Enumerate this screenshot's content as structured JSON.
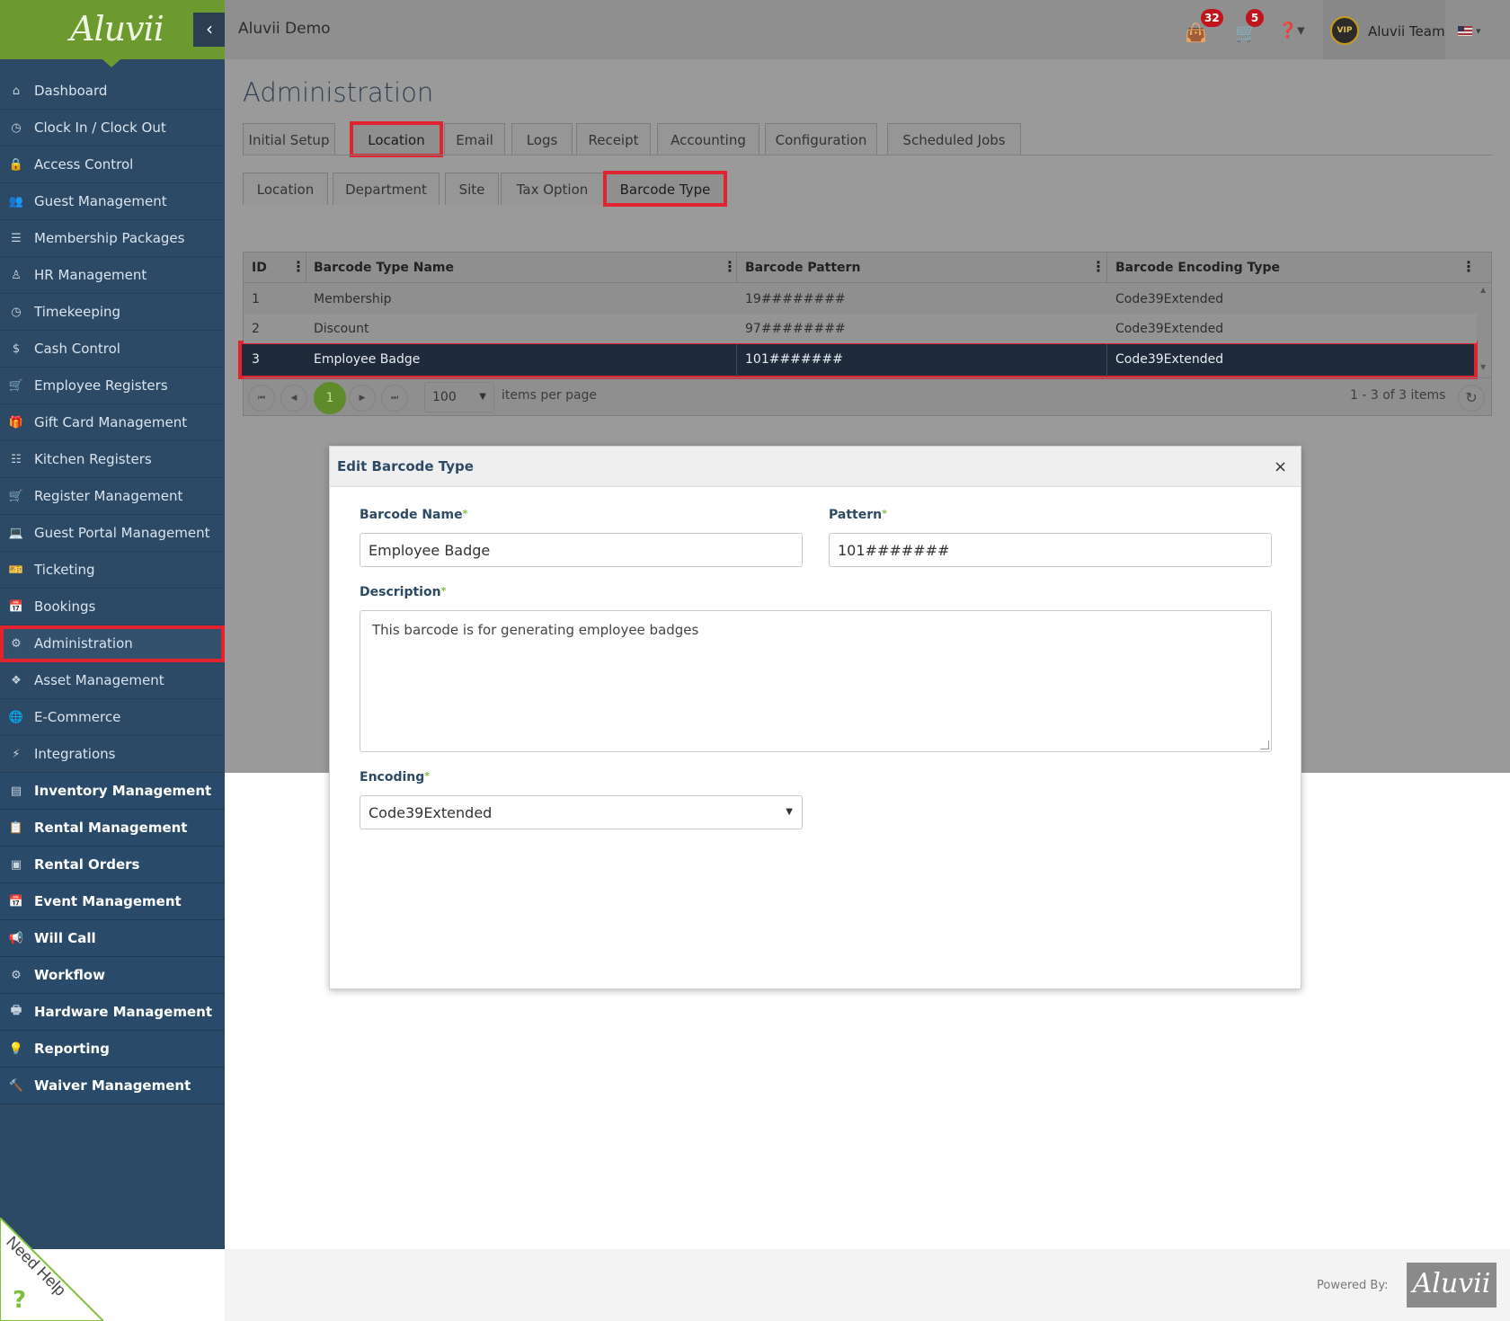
{
  "app": {
    "logo": "Aluvii",
    "title": "Aluvii Demo",
    "collapse_icon": "chevron-left-icon"
  },
  "topbar": {
    "bag_badge": "32",
    "cart_badge": "5",
    "user_name": "Aluvii Team",
    "avatar_text": "VIP",
    "help_icon": "question-circle-icon",
    "language": "en-US"
  },
  "sidebar": {
    "items": [
      {
        "label": "Dashboard",
        "icon": "home-icon",
        "glyph": "⌂"
      },
      {
        "label": "Clock In / Clock Out",
        "icon": "clock-icon",
        "glyph": "◷"
      },
      {
        "label": "Access Control",
        "icon": "lock-icon",
        "glyph": "🔒"
      },
      {
        "label": "Guest Management",
        "icon": "users-icon",
        "glyph": "👥"
      },
      {
        "label": "Membership Packages",
        "icon": "list-icon",
        "glyph": "☰"
      },
      {
        "label": "HR Management",
        "icon": "user-tie-icon",
        "glyph": "♙"
      },
      {
        "label": "Timekeeping",
        "icon": "clock-icon",
        "glyph": "◷"
      },
      {
        "label": "Cash Control",
        "icon": "dollar-icon",
        "glyph": "$"
      },
      {
        "label": "Employee Registers",
        "icon": "cart-icon",
        "glyph": "🛒"
      },
      {
        "label": "Gift Card Management",
        "icon": "gift-icon",
        "glyph": "🎁"
      },
      {
        "label": "Kitchen Registers",
        "icon": "list-ul-icon",
        "glyph": "☷"
      },
      {
        "label": "Register Management",
        "icon": "cart-icon",
        "glyph": "🛒"
      },
      {
        "label": "Guest Portal Management",
        "icon": "laptop-icon",
        "glyph": "💻"
      },
      {
        "label": "Ticketing",
        "icon": "ticket-icon",
        "glyph": "🎫"
      },
      {
        "label": "Bookings",
        "icon": "calendar-icon",
        "glyph": "📅"
      },
      {
        "label": "Administration",
        "icon": "cogs-icon",
        "glyph": "⚙",
        "active": true
      },
      {
        "label": "Asset Management",
        "icon": "cubes-icon",
        "glyph": "❖"
      },
      {
        "label": "E-Commerce",
        "icon": "globe-icon",
        "glyph": "🌐"
      },
      {
        "label": "Integrations",
        "icon": "bolt-icon",
        "glyph": "⚡"
      },
      {
        "label": "Inventory Management",
        "icon": "archive-icon",
        "glyph": "▤",
        "white": true
      },
      {
        "label": "Rental Management",
        "icon": "clipboard-icon",
        "glyph": "📋",
        "white": true
      },
      {
        "label": "Rental Orders",
        "icon": "file-icon",
        "glyph": "▣",
        "white": true
      },
      {
        "label": "Event Management",
        "icon": "calendar-check-icon",
        "glyph": "📅",
        "white": true
      },
      {
        "label": "Will Call",
        "icon": "bullhorn-icon",
        "glyph": "📢",
        "white": true
      },
      {
        "label": "Workflow",
        "icon": "gear-icon",
        "glyph": "⚙",
        "white": true
      },
      {
        "label": "Hardware Management",
        "icon": "print-icon",
        "glyph": "🖶",
        "white": true
      },
      {
        "label": "Reporting",
        "icon": "lightbulb-icon",
        "glyph": "💡",
        "white": true
      },
      {
        "label": "Waiver Management",
        "icon": "gavel-icon",
        "glyph": "🔨",
        "white": true
      }
    ]
  },
  "page": {
    "title": "Administration",
    "tabs": [
      "Initial Setup",
      "Location",
      "Email",
      "Logs",
      "Receipt",
      "Accounting",
      "Configuration",
      "Scheduled Jobs"
    ],
    "active_tab": "Location",
    "subtabs": [
      "Location",
      "Department",
      "Site",
      "Tax Option",
      "Barcode Type"
    ],
    "active_subtab": "Barcode Type"
  },
  "grid": {
    "columns": [
      "ID",
      "Barcode Type Name",
      "Barcode Pattern",
      "Barcode Encoding Type"
    ],
    "rows": [
      [
        "1",
        "Membership",
        "19########",
        "Code39Extended"
      ],
      [
        "2",
        "Discount",
        "97########",
        "Code39Extended"
      ],
      [
        "3",
        "Employee Badge",
        "101#######",
        "Code39Extended"
      ]
    ],
    "selected_row": "3",
    "pager": {
      "current_page": "1",
      "page_size": "100",
      "items_per_page_label": "items per page",
      "summary": "1 - 3 of 3 items"
    }
  },
  "modal": {
    "title": "Edit Barcode Type",
    "close": "×",
    "fields": {
      "name_label": "Barcode Name",
      "name_value": "Employee Badge",
      "pattern_label": "Pattern",
      "pattern_value": "101#######",
      "description_label": "Description",
      "description_value": "This barcode is for generating employee badges",
      "encoding_label": "Encoding",
      "encoding_value": "Code39Extended"
    },
    "required_mark": "*"
  },
  "footer": {
    "powered_by": "Powered By:",
    "logo": "Aluvii",
    "need_help": "Need Help"
  }
}
